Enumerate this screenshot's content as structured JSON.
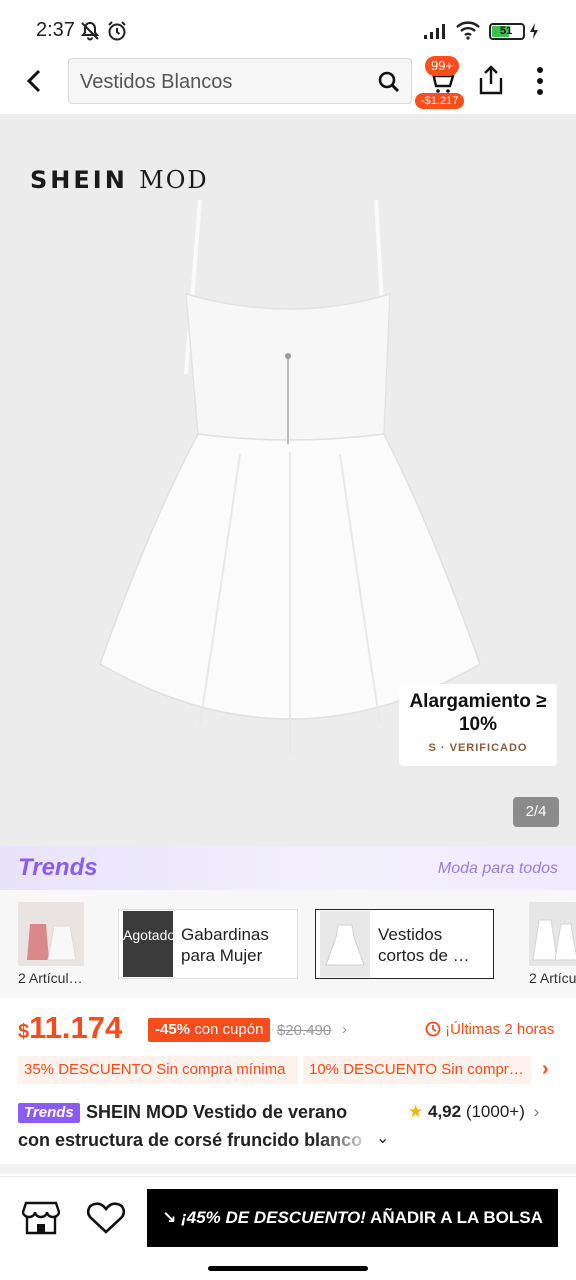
{
  "status_bar": {
    "time": "2:37",
    "battery": "51"
  },
  "header": {
    "search_query": "Vestidos Blancos",
    "cart_badge": "99+",
    "cart_price": "-$1.217"
  },
  "gallery": {
    "brand": "SHEIN",
    "brand_suffix": "MOD",
    "stretch_title": "Alargamiento ≥ 10%",
    "stretch_verified": "S · VERIFICADO",
    "counter": "2/4"
  },
  "trends": {
    "logo": "Trends",
    "slogan": "Moda para todos",
    "left_label": "2 Artícul…",
    "right_label": "2 Artícu",
    "cards": [
      {
        "thumb_text": "Agotado",
        "label_line1": "Gabardinas",
        "label_line2": "para Mujer"
      },
      {
        "thumb_text": "",
        "label_line1": "Vestidos",
        "label_line2": "cortos de …"
      }
    ]
  },
  "price": {
    "currency": "$",
    "amount": "11.174",
    "discount": "-45%",
    "discount_suffix": "con cupón",
    "original": "$20.490",
    "timer": "¡Últimas 2 horas"
  },
  "coupons": [
    "35% DESCUENTO Sin compra mínima",
    "10% DESCUENTO Sin compr…"
  ],
  "product": {
    "badge": "Trends",
    "title_line1": "SHEIN MOD Vestido de verano",
    "title_line2": "con estructura de corsé fruncido blanco",
    "rating": "4,92",
    "review_count": "(1000+)"
  },
  "bottom": {
    "add_prefix": "¡45% DE DESCUENTO!",
    "add_suffix": "AÑADIR A LA BOLSA"
  }
}
